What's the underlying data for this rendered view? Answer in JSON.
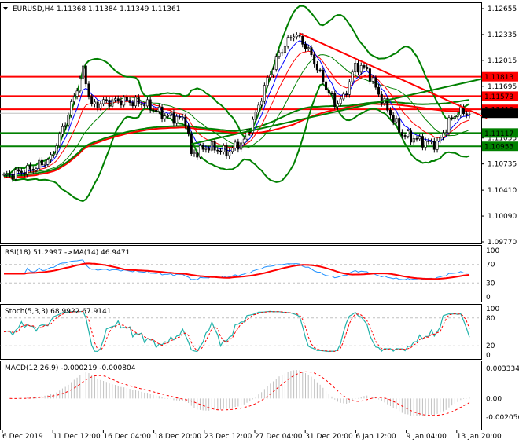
{
  "chart_data": {
    "type": "line",
    "title": "EURUSD,H4",
    "ohlc_readout": [
      "1.11368",
      "1.11384",
      "1.11349",
      "1.11361"
    ],
    "price_axis": {
      "range": [
        1.0977,
        1.12655
      ],
      "ticks": [
        "1.12655",
        "1.12335",
        "1.12015",
        "1.11695",
        "1.11055",
        "1.10735",
        "1.10410",
        "1.10090",
        "1.09770"
      ]
    },
    "time_labels": [
      "6 Dec 2019",
      "11 Dec 12:00",
      "16 Dec 04:00",
      "18 Dec 20:00",
      "23 Dec 12:00",
      "27 Dec 04:00",
      "31 Dec 20:00",
      "6 Jan 12:00",
      "9 Jan 04:00",
      "13 Jan 20:00"
    ],
    "close_anchors": {
      "bar_index": [
        0,
        10,
        16,
        22,
        27,
        30,
        34,
        40,
        48,
        55,
        62,
        64,
        70,
        76,
        82,
        86,
        90,
        94,
        99,
        103,
        106,
        110,
        113,
        116,
        120,
        124,
        128,
        132,
        136,
        140,
        144,
        148,
        152,
        155,
        159
      ],
      "close": [
        1.1058,
        1.1068,
        1.108,
        1.1135,
        1.119,
        1.1145,
        1.115,
        1.1152,
        1.1148,
        1.1133,
        1.1128,
        1.1085,
        1.1095,
        1.1088,
        1.1102,
        1.1135,
        1.1178,
        1.121,
        1.1235,
        1.122,
        1.12,
        1.1168,
        1.1148,
        1.1155,
        1.1195,
        1.119,
        1.116,
        1.1135,
        1.111,
        1.1105,
        1.11,
        1.1098,
        1.1125,
        1.1138,
        1.1136
      ]
    },
    "bar_count": 160,
    "levels": [
      {
        "label": "1.11813",
        "value": 1.11813,
        "color": "#ff0000"
      },
      {
        "label": "1.11573",
        "value": 1.11573,
        "color": "#ff0000"
      },
      {
        "label": "1.11410",
        "value": 1.1141,
        "color": "#ff0000"
      },
      {
        "label": "1.11117",
        "value": 1.11117,
        "color": "#008000"
      },
      {
        "label": "1.10953",
        "value": 1.10953,
        "color": "#008000"
      }
    ],
    "current_price": {
      "label": "1.11361",
      "value": 1.11361
    },
    "trendlines": [
      {
        "name": "red-downtrend",
        "from": [
          101,
          1.1235
        ],
        "to": [
          165,
          1.113
        ],
        "color": "#ff0000"
      },
      {
        "name": "green-uptrend",
        "from": [
          64,
          1.1098
        ],
        "to": [
          165,
          1.118
        ],
        "color": "#008000"
      }
    ],
    "rsi": {
      "label": "RSI(18) 51.2997  ->MA(14) 46.9471",
      "period": 18,
      "ma": 14,
      "ticks": [
        "100",
        "70",
        "30",
        "0"
      ],
      "levels": [
        70,
        30
      ]
    },
    "stoch": {
      "label": "Stoch(5,3,3) 68.9922 67.9141",
      "ticks": [
        "100",
        "80",
        "20",
        "0"
      ],
      "levels": [
        80,
        20
      ]
    },
    "macd": {
      "label": "MACD(12,26,9) -0.000219 -0.000804",
      "ticks": [
        "0.003334",
        "0.00",
        "-0.002056"
      ],
      "range": [
        -0.002056,
        0.003334
      ]
    },
    "colors": {
      "bollinger": "#008000",
      "fast_ma": "#0000ff",
      "slow_ma": "#ff0000",
      "rsi": "#1e90ff",
      "stoch_main": "#20b2aa",
      "signal": "#ff0000",
      "histogram": "#c0c0c0"
    }
  }
}
